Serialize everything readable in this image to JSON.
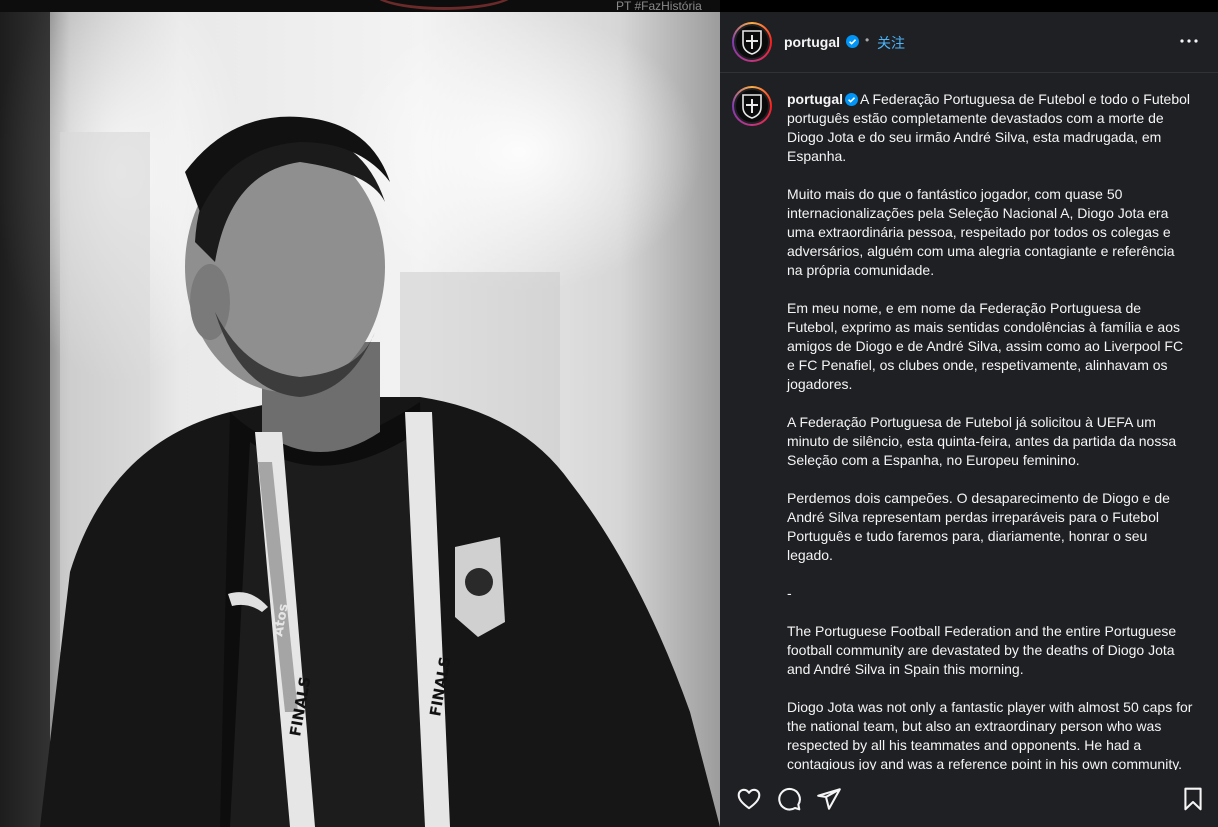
{
  "photo": {
    "hashtag": "PT #FazHistória",
    "lanyard_text": [
      "Atos",
      "FINALS"
    ]
  },
  "post": {
    "username": "portugal",
    "verified": true,
    "dot": "•",
    "follow_label": "关注",
    "caption": "A Federação Portuguesa de Futebol e todo o Futebol português estão completamente devastados com a morte de Diogo Jota e do seu irmão André Silva, esta madrugada, em Espanha.\n\nMuito mais do que o fantástico jogador, com quase 50 internacionalizações pela Seleção Nacional A, Diogo Jota era uma extraordinária pessoa, respeitado por todos os colegas e adversários, alguém com uma alegria contagiante e referência na própria comunidade.\n\nEm meu nome, e em nome da Federação Portuguesa de Futebol, exprimo as mais sentidas condolências à família e aos amigos de Diogo e de André Silva, assim como ao Liverpool FC e FC Penafiel, os clubes onde, respetivamente, alinhavam os jogadores.\n\nA Federação Portuguesa de Futebol já solicitou à UEFA um minuto de silêncio, esta quinta-feira, antes da partida da nossa Seleção com a Espanha, no Europeu feminino.\n\nPerdemos dois campeões. O desaparecimento de Diogo e de André Silva representam perdas irreparáveis para o Futebol Português e tudo faremos para, diariamente, honrar o seu legado.\n\n-\n\nThe Portuguese Football Federation and the entire Portuguese football community are devastated by the deaths of Diogo Jota and André Silva in Spain this morning.\n\nDiogo Jota was not only a fantastic player with almost 50 caps for the national team, but also an extraordinary person who was respected by all his teammates and opponents. He had a contagious joy and was a reference point in his own community."
  },
  "actions": {
    "icons": [
      "heart-icon",
      "comment-icon",
      "share-icon",
      "bookmark-icon"
    ]
  },
  "colors": {
    "panel_bg": "#1f2024",
    "link_blue": "#4cb5f9",
    "verified_blue": "#0095f6"
  }
}
